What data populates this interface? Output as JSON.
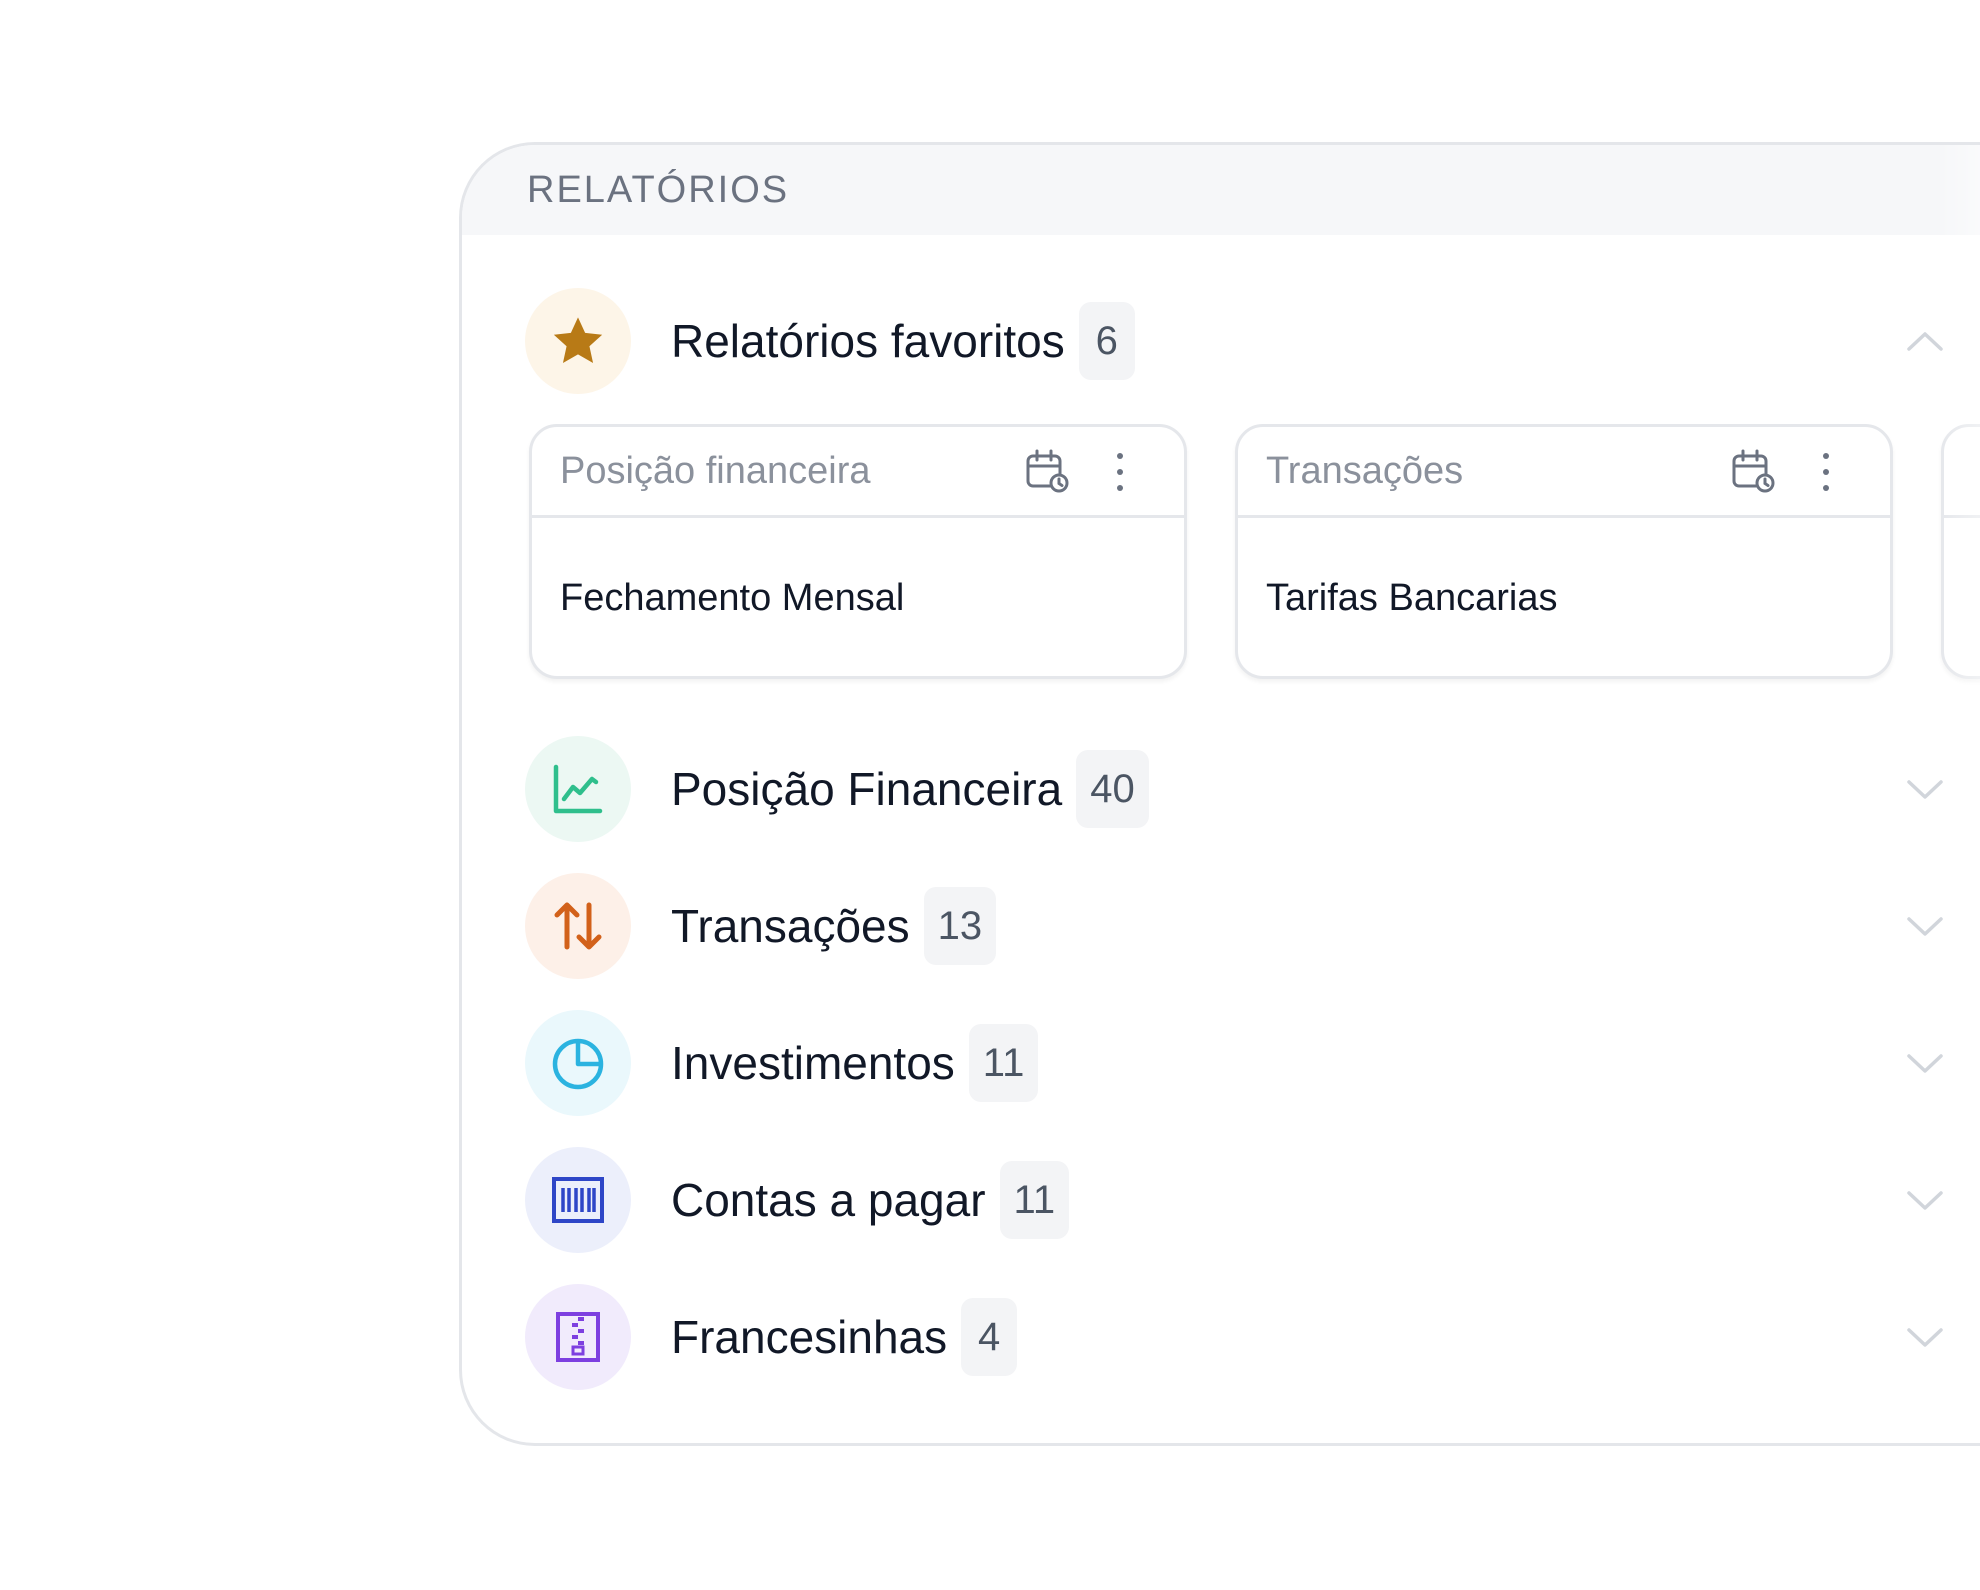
{
  "panel": {
    "title": "RELATÓRIOS"
  },
  "favorites": {
    "label": "Relatórios favoritos",
    "count": "6",
    "icon": "star-icon",
    "icon_color": "#b87a16",
    "icon_bg": "#fdf5e8",
    "expanded": true,
    "cards": [
      {
        "type": "Posição financeira",
        "name": "Fechamento Mensal"
      },
      {
        "type": "Transações",
        "name": "Tarifas Bancarias"
      }
    ]
  },
  "categories": [
    {
      "label": "Posição Financeira",
      "count": "40",
      "icon": "line-chart-icon",
      "icon_color": "#2fbf8c",
      "icon_bg": "#ecf8f3"
    },
    {
      "label": "Transações",
      "count": "13",
      "icon": "arrows-up-down-icon",
      "icon_color": "#d2611a",
      "icon_bg": "#fdf0e8"
    },
    {
      "label": "Investimentos",
      "count": "11",
      "icon": "pie-chart-icon",
      "icon_color": "#2bb3e0",
      "icon_bg": "#eaf8fc"
    },
    {
      "label": "Contas a pagar",
      "count": "11",
      "icon": "barcode-icon",
      "icon_color": "#2e46c7",
      "icon_bg": "#eceffb"
    },
    {
      "label": "Francesinhas",
      "count": "4",
      "icon": "zip-file-icon",
      "icon_color": "#7d3fe0",
      "icon_bg": "#f1ebfc"
    }
  ]
}
